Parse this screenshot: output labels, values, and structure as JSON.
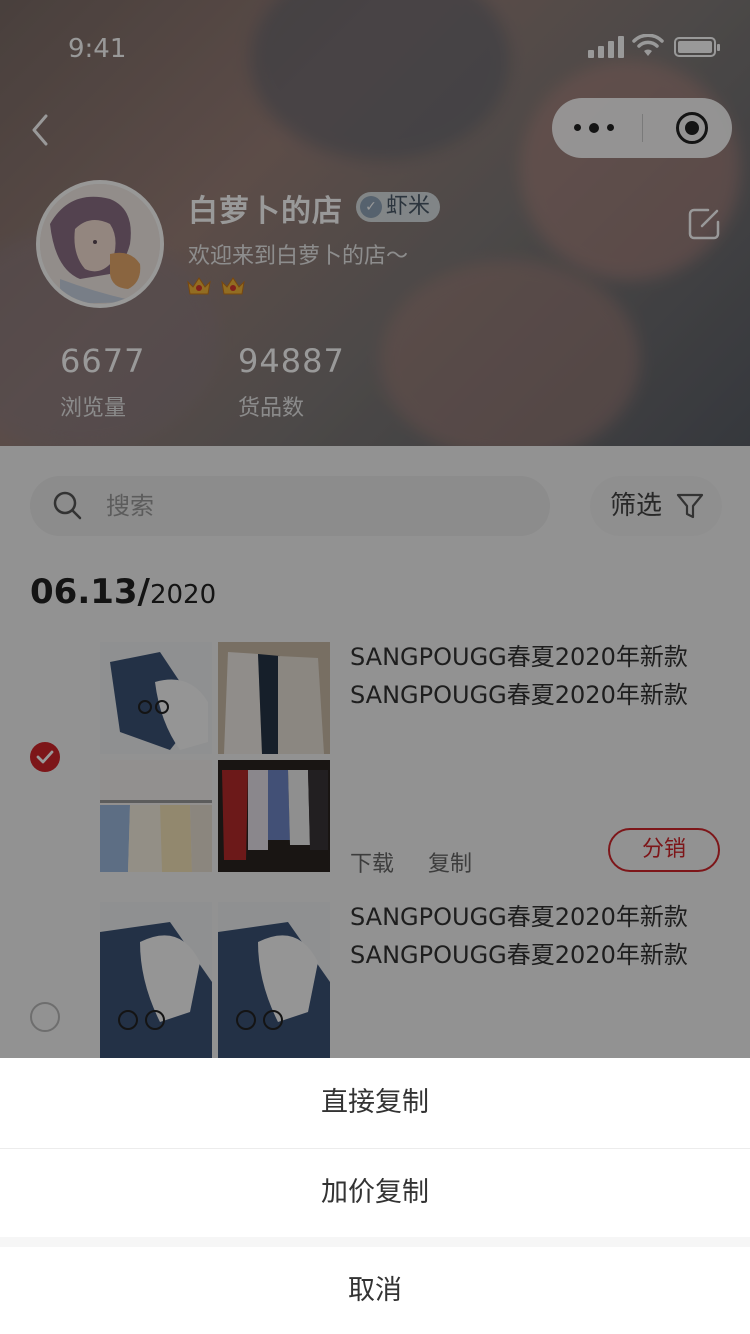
{
  "status_bar": {
    "time": "9:41"
  },
  "shop": {
    "name": "白萝卜的店",
    "badge": "虾米",
    "welcome": "欢迎来到白萝卜的店～"
  },
  "stats": [
    {
      "value": "6677",
      "label": "浏览量"
    },
    {
      "value": "94887",
      "label": "货品数"
    }
  ],
  "search": {
    "placeholder": "搜索"
  },
  "filter": {
    "label": "筛选"
  },
  "date_group": {
    "date": "06.13/",
    "year": "2020"
  },
  "products": [
    {
      "title_line1": "SANGPOUGG春夏2020年新款",
      "title_line2": "SANGPOUGG春夏2020年新款",
      "selected": true,
      "actions": {
        "download": "下载",
        "copy": "复制",
        "distribute": "分销"
      }
    },
    {
      "title_line1": "SANGPOUGG春夏2020年新款",
      "title_line2": "SANGPOUGG春夏2020年新款",
      "selected": false
    }
  ],
  "action_sheet": {
    "option1": "直接复制",
    "option2": "加价复制",
    "cancel": "取消"
  },
  "colors": {
    "accent": "#d0252b"
  }
}
